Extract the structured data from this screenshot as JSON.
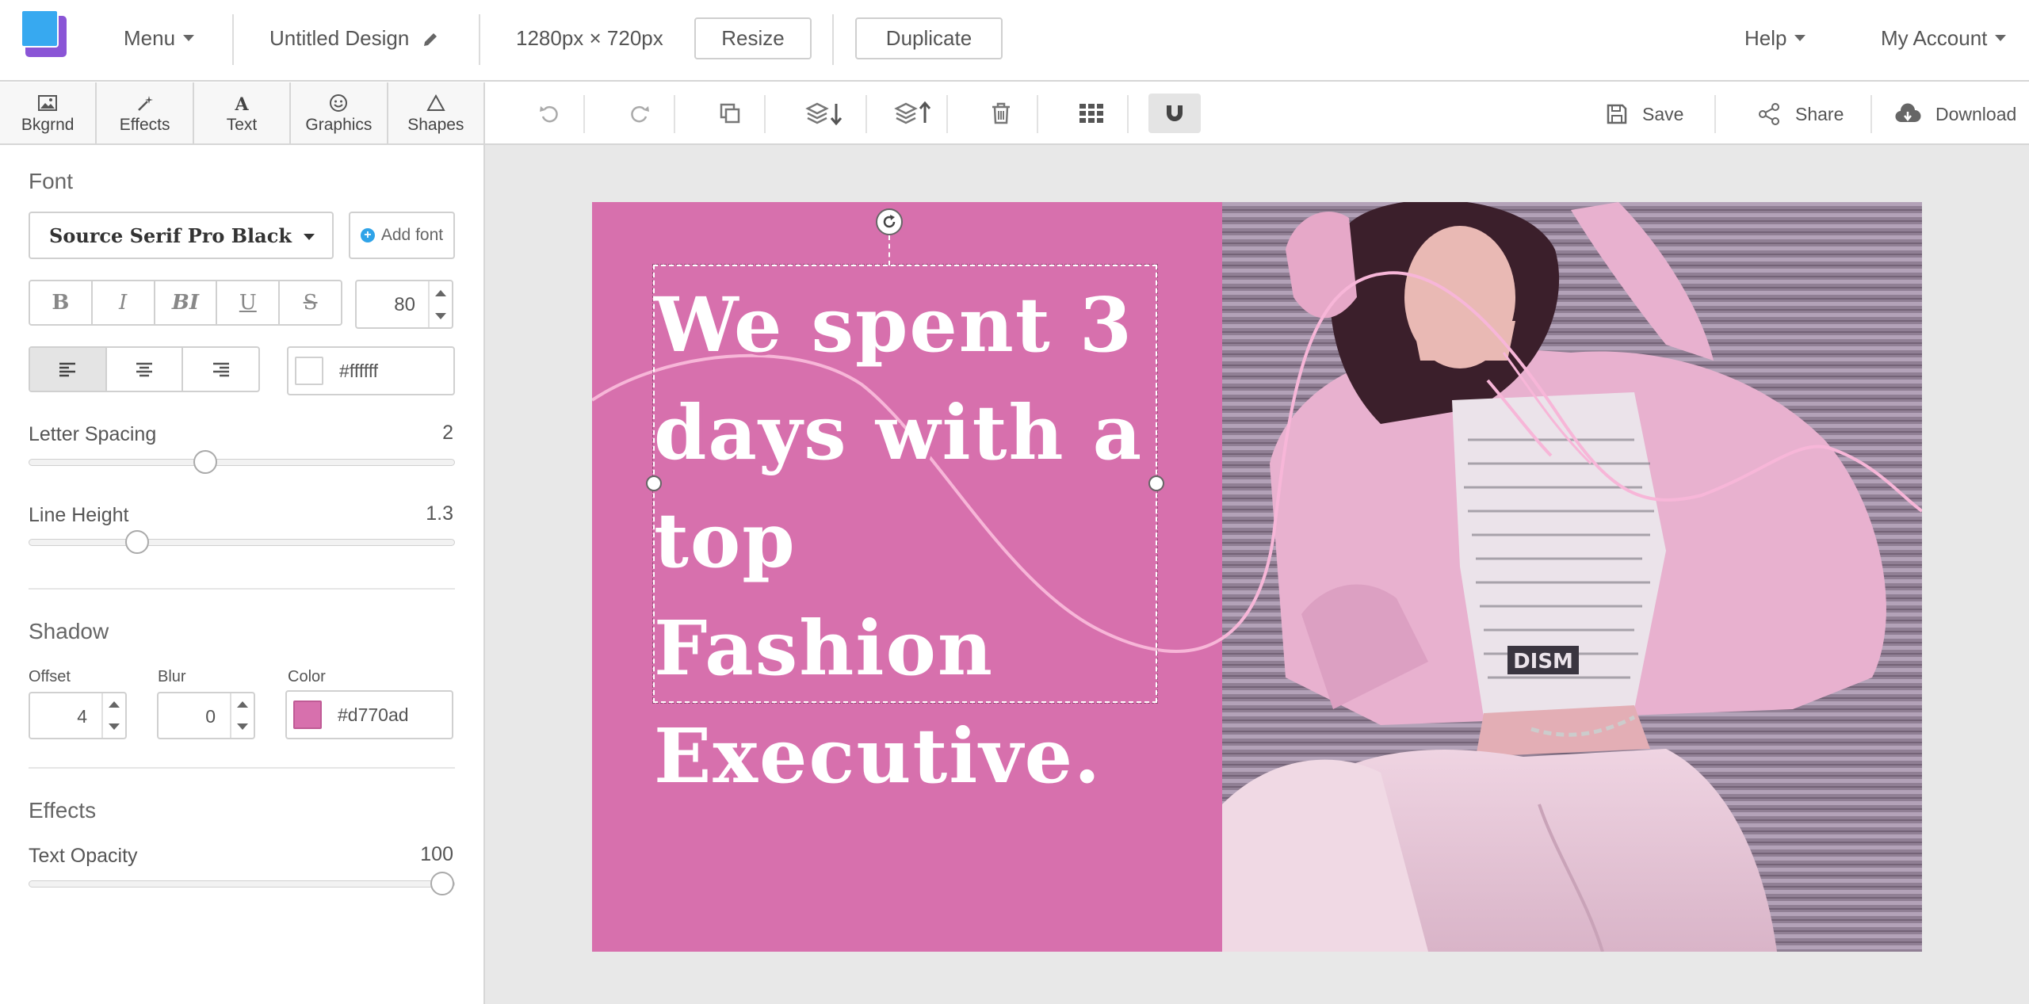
{
  "topbar": {
    "menu_label": "Menu",
    "design_title": "Untitled Design",
    "dimensions": "1280px × 720px",
    "resize_label": "Resize",
    "duplicate_label": "Duplicate",
    "help_label": "Help",
    "account_label": "My Account"
  },
  "tool_tabs": [
    {
      "label": "Bkgrnd",
      "icon": "image-icon"
    },
    {
      "label": "Effects",
      "icon": "magic-wand-icon"
    },
    {
      "label": "Text",
      "icon": "text-icon"
    },
    {
      "label": "Graphics",
      "icon": "smiley-icon"
    },
    {
      "label": "Shapes",
      "icon": "triangle-icon"
    }
  ],
  "actions": {
    "icons": [
      "undo-icon",
      "redo-icon",
      "duplicate-icon",
      "send-backward-icon",
      "bring-forward-icon",
      "trash-icon",
      "grid-icon",
      "magnet-icon"
    ],
    "save_label": "Save",
    "share_label": "Share",
    "download_label": "Download"
  },
  "font_panel": {
    "title": "Font",
    "font_family": "Source Serif Pro Black",
    "add_font_label": "Add font",
    "style_buttons": [
      "B",
      "I",
      "BI",
      "U",
      "S"
    ],
    "font_size": "80",
    "alignments": [
      "align-left",
      "align-center",
      "align-right"
    ],
    "active_alignment": "align-left",
    "font_color": "#ffffff",
    "letter_spacing_label": "Letter Spacing",
    "letter_spacing_value": "2",
    "letter_spacing_level": 0.41,
    "line_height_label": "Line Height",
    "line_height_value": "1.3",
    "line_height_level": 0.24
  },
  "shadow_panel": {
    "title": "Shadow",
    "offset_label": "Offset",
    "offset_value": "4",
    "blur_label": "Blur",
    "blur_value": "0",
    "color_label": "Color",
    "color_value": "#d770ad"
  },
  "effects_panel": {
    "title": "Effects",
    "opacity_label": "Text Opacity",
    "opacity_value": "100",
    "opacity_level": 1.0
  },
  "canvas": {
    "headline": "We spent 3\ndays with a\ntop Fashion\nExecutive.",
    "panel_color": "#d770ad",
    "accent_line_color": "#f7b6d8"
  }
}
